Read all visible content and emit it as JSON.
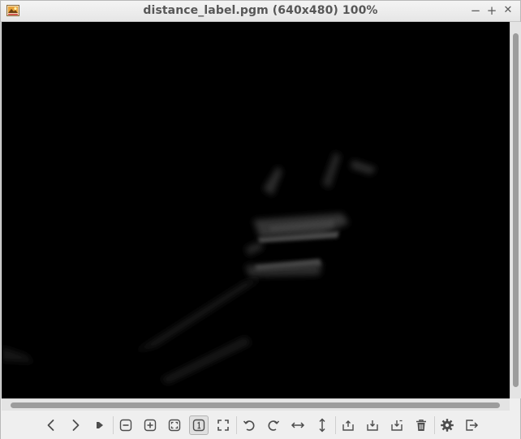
{
  "window": {
    "title": "distance_label.pgm (640x480) 100%",
    "controls": {
      "minimize": "−",
      "maximize": "+",
      "close": "✕"
    }
  },
  "icons": [
    "app-image-icon",
    "previous-icon",
    "next-icon",
    "slideshow-play-icon",
    "zoom-out-icon",
    "zoom-in-icon",
    "zoom-fit-icon",
    "zoom-100-icon",
    "fullscreen-icon",
    "rotate-left-icon",
    "rotate-right-icon",
    "flip-horizontal-icon",
    "flip-vertical-icon",
    "open-icon",
    "save-icon",
    "save-as-icon",
    "delete-icon",
    "settings-icon",
    "exit-icon"
  ],
  "colors": {
    "canvas": "#000000",
    "icon": "#4d4d4d",
    "title_text": "#575757",
    "scroll_thumb": "#9c9c9c"
  }
}
